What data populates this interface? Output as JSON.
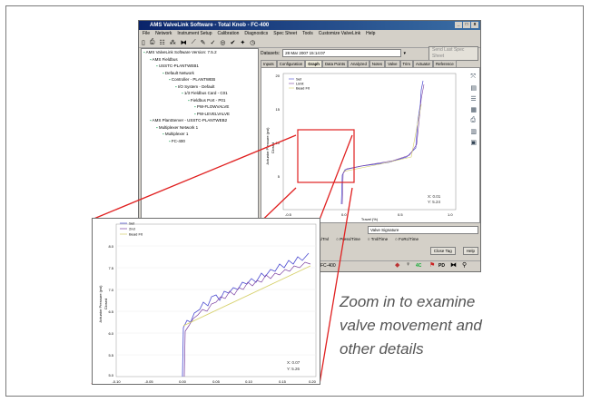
{
  "window": {
    "title": "AMS ValveLink Software - Total Knob - FC-400",
    "controls": [
      "_",
      "□",
      "x"
    ],
    "menu": [
      "File",
      "Network",
      "Instrument Setup",
      "Calibration",
      "Diagnostics",
      "Spec Sheet",
      "Tools",
      "Customize ValveLink",
      "Help"
    ]
  },
  "tree": {
    "items": [
      {
        "label": "AMS ValveLink Software Version: 7.5.2",
        "indent": 0
      },
      {
        "label": "AMS Fieldbus",
        "indent": 1
      },
      {
        "label": "USSTC-PLANTWEB1",
        "indent": 2
      },
      {
        "label": "Default Network",
        "indent": 3
      },
      {
        "label": "Controller - PLANTWEB",
        "indent": 4
      },
      {
        "label": "I/O System - Default",
        "indent": 5
      },
      {
        "label": "1/3 Fieldbus Card - C01",
        "indent": 6
      },
      {
        "label": "Fieldbus Port - P01",
        "indent": 7
      },
      {
        "label": "PW-FLOWVALVE",
        "indent": 8
      },
      {
        "label": "PW-LEVELVALVE",
        "indent": 8
      },
      {
        "label": "AMS PlantServer - USSTC-PLANTWEB2",
        "indent": 1
      },
      {
        "label": "Multiplexer Network 1",
        "indent": 2
      },
      {
        "label": "Multiplexer 1",
        "indent": 3
      },
      {
        "label": "FC-400",
        "indent": 4
      }
    ]
  },
  "dataset": {
    "label": "Datasets:",
    "value": "28 Mar 2007 15:14:07",
    "button": "Send Last Spec Sheet"
  },
  "tabs": [
    "Inputs",
    "Configuration",
    "Graph",
    "Data Points",
    "Analyzed",
    "Notes",
    "Valve",
    "Trim",
    "Actuator",
    "Reference"
  ],
  "active_tab": "Graph",
  "graph": {
    "ylabel": "Actuator Pressure (psi)",
    "xlabel": "Travel (%)",
    "legend": [
      "Set",
      "Limit",
      "Bead Fit"
    ],
    "xticks": [
      "-0.5",
      "0.0",
      "0.5",
      "1.0"
    ],
    "yticks": [
      "20",
      "15",
      "10",
      "5"
    ],
    "readout_x": "X: 0.01",
    "readout_y": "Y: 5.24",
    "closed_label": "Closed"
  },
  "controls": {
    "zoom_back": "Zoom Back",
    "add_trend": "Add Trend",
    "dropdown": "Valve Signature",
    "radios": [
      "Press/Trvl",
      "Press/Time",
      "Trvl/Time",
      "FoRc/Time"
    ],
    "delete_dataset": "Delete Dataset",
    "close_tag": "Close Tag",
    "help": "Help"
  },
  "status": {
    "tag": "FC-400",
    "pd_label": "PD",
    "badge": "4C"
  },
  "zoom": {
    "legend": [
      "Set",
      "2nd",
      "Bead Fit"
    ],
    "ylabel": "Actuator Pressure (psi)",
    "closed_label": "Closed",
    "yticks": [
      "8.0",
      "7.5",
      "7.0",
      "6.5",
      "6.0",
      "5.5",
      "5.0"
    ],
    "xticks": [
      "-0.10",
      "-0.05",
      "0.00",
      "0.05",
      "0.10",
      "0.15",
      "0.20"
    ],
    "readout_x": "X: 0.07",
    "readout_y": "Y: 5.26"
  },
  "caption": [
    "Zoom in to examine",
    "valve movement and",
    "other details"
  ],
  "colors": {
    "series1": "#4a4ad0",
    "series2": "#7a3fa0",
    "fit": "#d6d06a",
    "zoom_box": "#e02020",
    "titlebar": "#0a246a"
  }
}
